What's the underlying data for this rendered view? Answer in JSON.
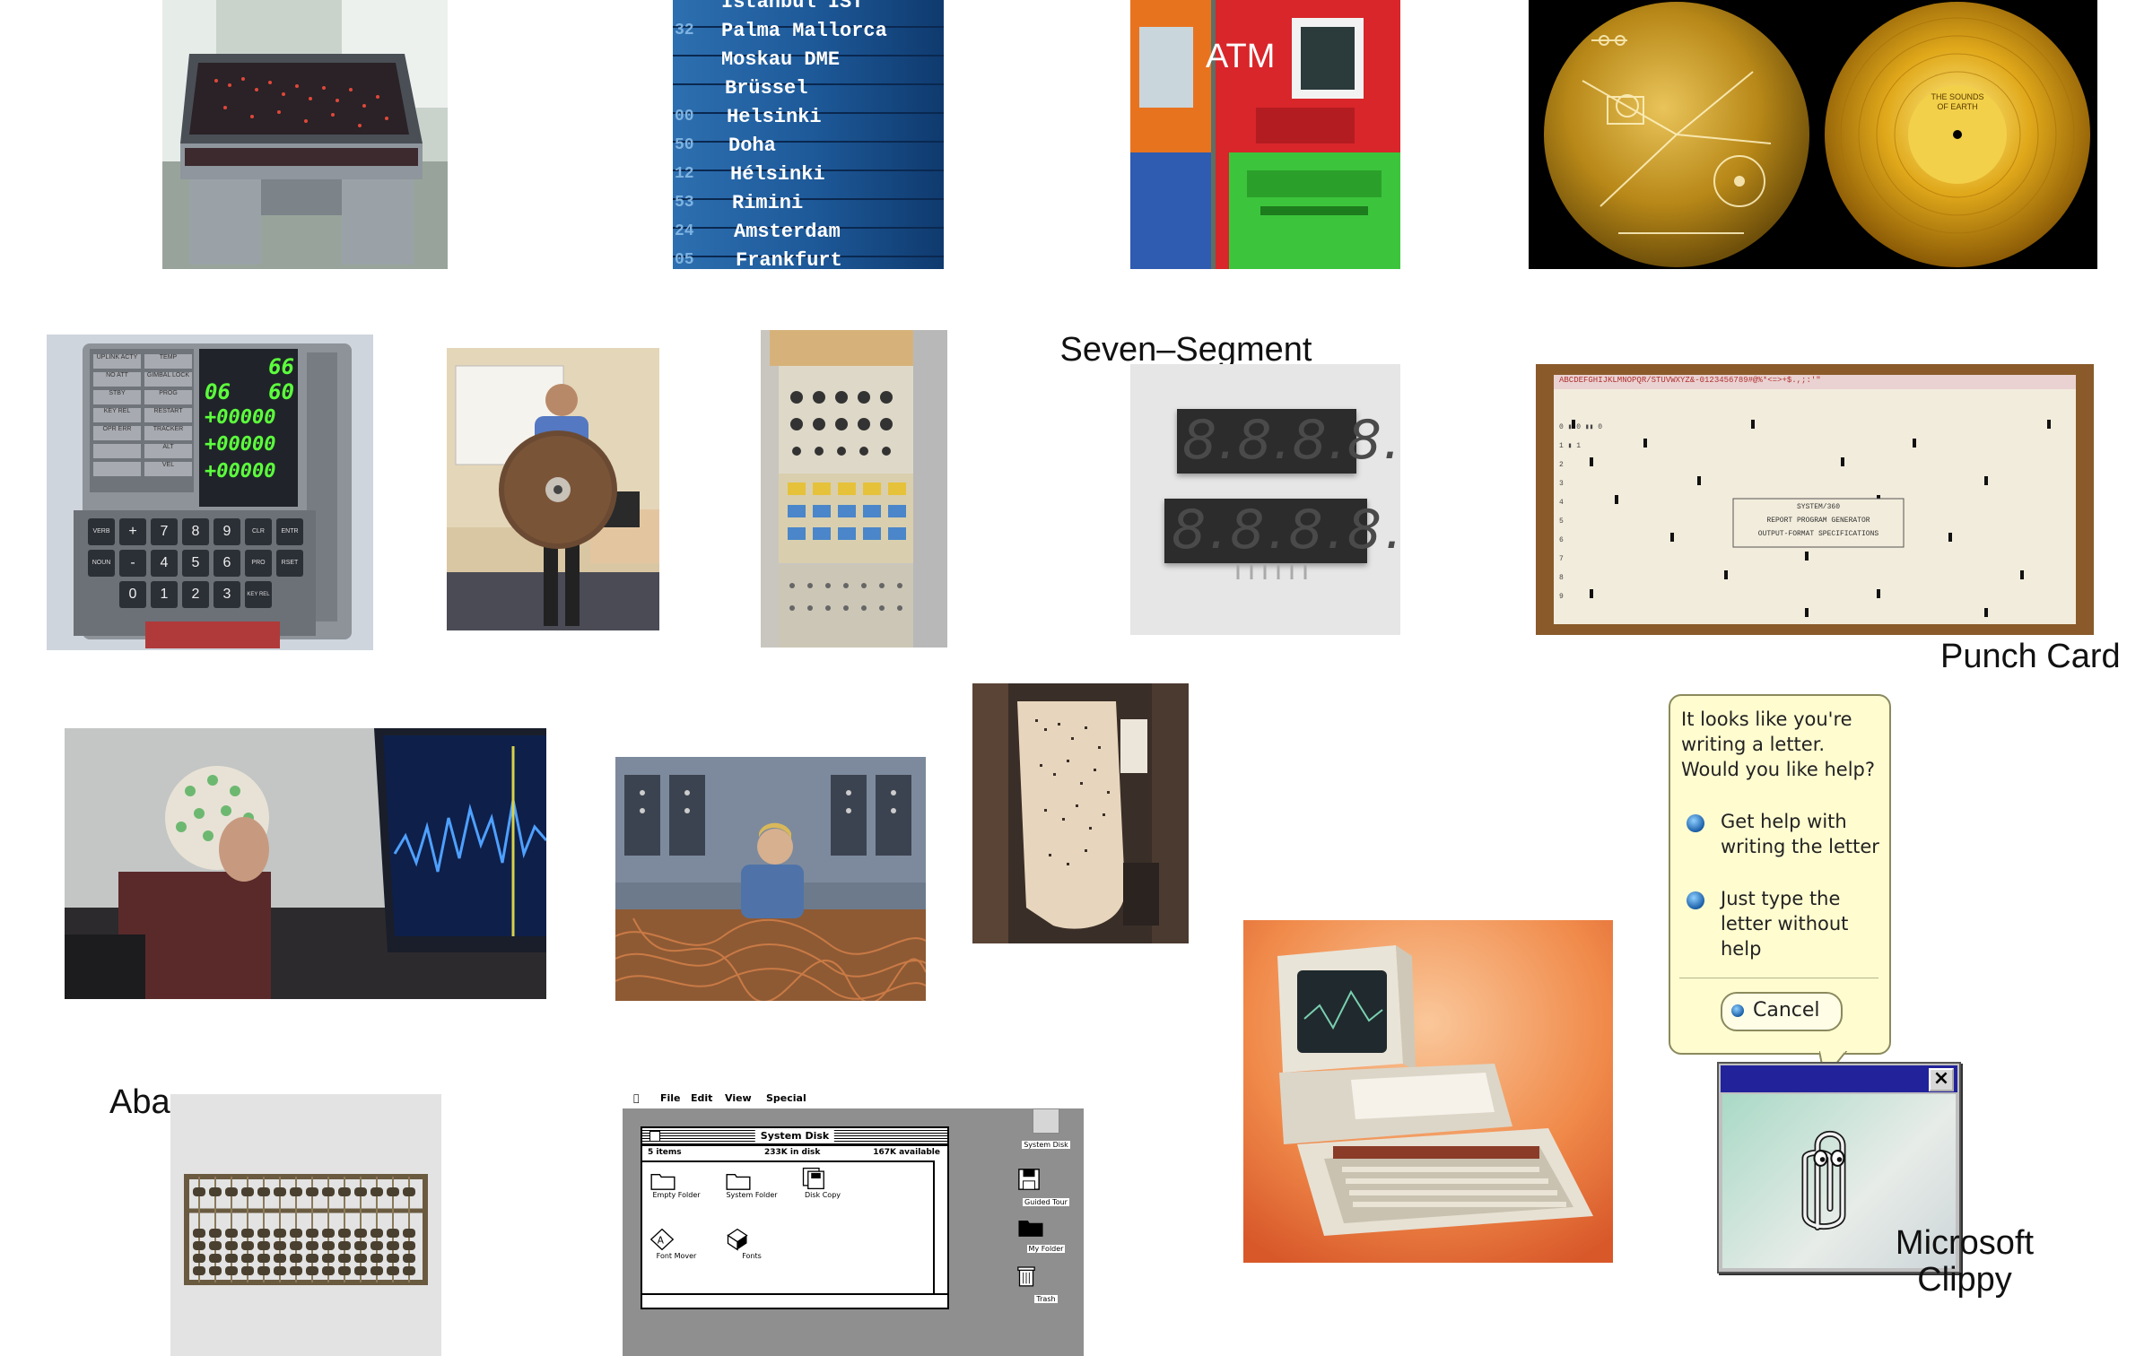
{
  "captions": {
    "atm": "ATM",
    "seven_segment": "Seven–Segment\nDisplay",
    "punch_card": "Punch Card",
    "abacus": "Abacus",
    "clippy": "Microsoft\nClippy"
  },
  "flight_board": {
    "destinations": [
      "Istanbul IST",
      "Palma Mallorca",
      "Moskau DME",
      "Brüssel",
      "Helsinki",
      "Doha",
      "Hélsinki",
      "Rimini",
      "Amsterdam",
      "Frankfurt"
    ],
    "codes": [
      "",
      "32",
      "",
      "",
      "00",
      "50",
      "12",
      "53",
      "24",
      "05"
    ]
  },
  "dsky": {
    "labels_left": [
      "UPLINK ACTY",
      "NO ATT",
      "STBY",
      "KEY REL",
      "OPR ERR",
      "TEMP",
      "GIMBAL LOCK",
      "PROG",
      "RESTART",
      "TRACKER",
      "ALT",
      "VEL"
    ],
    "readouts": [
      "66",
      "06",
      "60",
      "+00000",
      "+00000",
      "+00000"
    ],
    "keys": [
      "VERB",
      "NOUN",
      "+",
      "-",
      "0",
      "7",
      "4",
      "1",
      "8",
      "5",
      "2",
      "9",
      "6",
      "3",
      "CLR",
      "PRO",
      "KEY REL",
      "ENTR",
      "RSET"
    ]
  },
  "seven_segment": {
    "digits_top": "8.8.8.8.",
    "digits_bottom": "8.8.8.8."
  },
  "punch_card": {
    "header": "ABCDEFGHIJKLMNOPQR/STUVWXYZ&-0123456789#@%*<=>+$.,;:'\"",
    "center_line1": "SYSTEM/360",
    "center_line2": "REPORT PROGRAM GENERATOR",
    "center_line3": "OUTPUT-FORMAT SPECIFICATIONS",
    "row_digits": [
      "0",
      "1",
      "2",
      "3",
      "4",
      "5",
      "6",
      "7",
      "8",
      "9"
    ]
  },
  "clippy": {
    "bubble_text": "It looks like you're\nwriting a letter.\nWould you like help?",
    "option1": "Get help with\nwriting the letter",
    "option2": "Just type the\nletter without\nhelp",
    "cancel": "Cancel",
    "close_glyph": "×"
  },
  "mac": {
    "apple_glyph": "",
    "menu": [
      "File",
      "Edit",
      "View",
      "Special"
    ],
    "window_title": "System Disk",
    "info_items": "5 items",
    "info_disk": "233K in disk",
    "info_available": "167K available",
    "icons": [
      "Empty Folder",
      "System Folder",
      "Disk Copy",
      "Font Mover",
      "Fonts"
    ],
    "desktop_icons": [
      "System Disk",
      "Guided Tour",
      "My Folder",
      "Trash"
    ]
  },
  "voyager": {
    "record_label": "THE SOUNDS OF EARTH"
  },
  "colors": {
    "flight_blue": "#1e5a9a",
    "atm_red": "#d8262b",
    "atm_green": "#3cc53c",
    "atm_orange": "#e8731f",
    "gold": "#d8a21c",
    "seg_red": "#3a3a3a",
    "clippy_bubble": "#fffcd0",
    "mac_gray": "#8f8f8f"
  }
}
